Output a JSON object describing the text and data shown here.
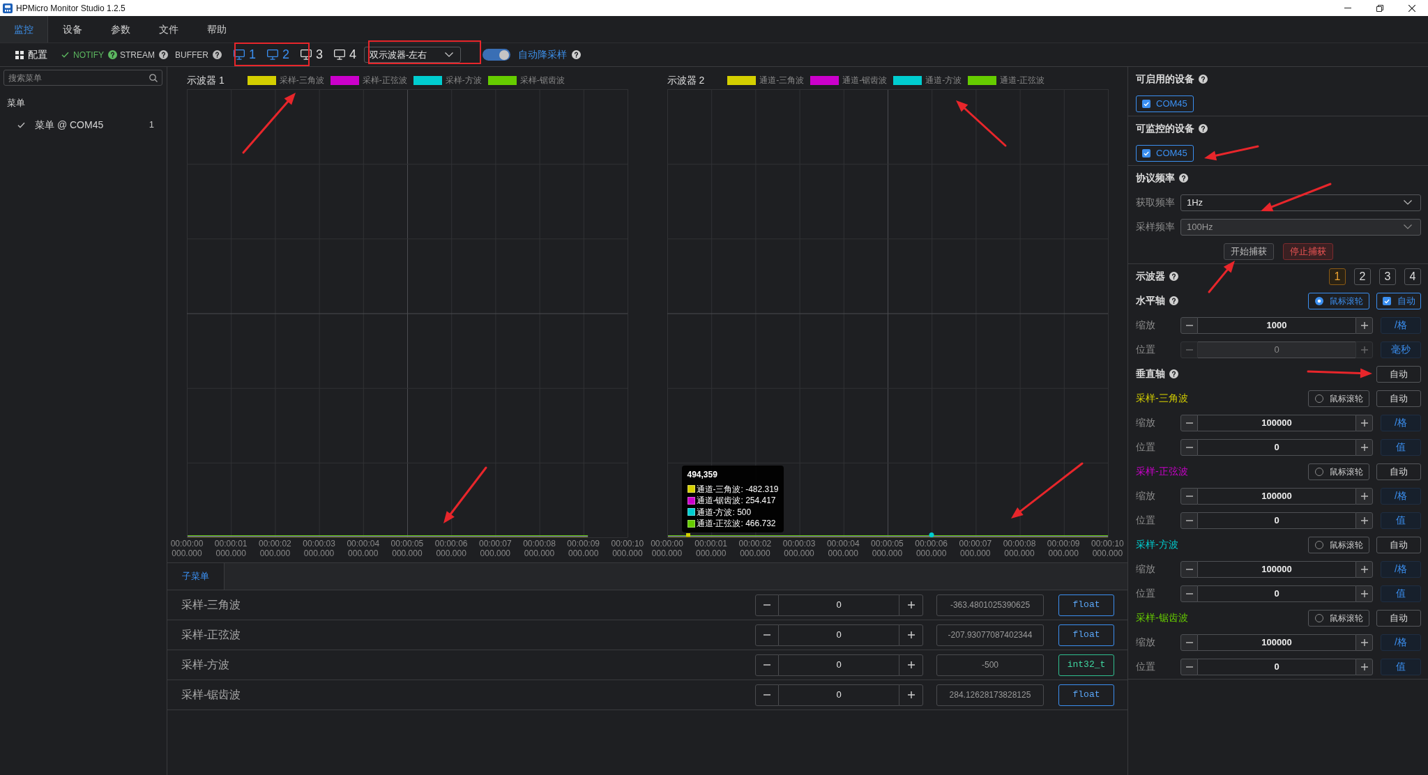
{
  "window": {
    "title": "HPMicro Monitor Studio 1.2.5"
  },
  "menu_tabs": [
    {
      "label": "监控",
      "selected": true
    },
    {
      "label": "设备",
      "selected": false
    },
    {
      "label": "参数",
      "selected": false
    },
    {
      "label": "文件",
      "selected": false
    },
    {
      "label": "帮助",
      "selected": false
    }
  ],
  "toolbar": {
    "config_label": "配置",
    "flags": [
      {
        "label": "NOTIFY",
        "active": true
      },
      {
        "label": "STREAM",
        "active": false
      },
      {
        "label": "BUFFER",
        "active": false
      }
    ],
    "scopes": [
      {
        "label": "1",
        "selected": true
      },
      {
        "label": "2",
        "selected": true
      },
      {
        "label": "3",
        "selected": false
      },
      {
        "label": "4",
        "selected": false
      }
    ],
    "layout_select": {
      "value": "双示波器-左右"
    },
    "auto_downsample": {
      "label": "自动降采样",
      "on": true
    }
  },
  "sidebar": {
    "search": {
      "placeholder": "搜索菜单"
    },
    "heading": "菜单",
    "items": [
      {
        "label": "菜单 @ COM45",
        "count": "1",
        "checked": true
      }
    ]
  },
  "oscilloscopes": [
    {
      "title": "示波器 1",
      "legend": [
        {
          "label": "采样-三角波",
          "color": "#d4cf00"
        },
        {
          "label": "采样-正弦波",
          "color": "#cc00cc"
        },
        {
          "label": "采样-方波",
          "color": "#00cdd0"
        },
        {
          "label": "采样-锯齿波",
          "color": "#66cc00"
        }
      ],
      "x_ticks": [
        {
          "time": "00:00:00",
          "fraction": "000.000"
        },
        {
          "time": "00:00:01",
          "fraction": "000.000"
        },
        {
          "time": "00:00:02",
          "fraction": "000.000"
        },
        {
          "time": "00:00:03",
          "fraction": "000.000"
        },
        {
          "time": "00:00:04",
          "fraction": "000.000"
        },
        {
          "time": "00:00:05",
          "fraction": "000.000"
        },
        {
          "time": "00:00:06",
          "fraction": "000.000"
        },
        {
          "time": "00:00:07",
          "fraction": "000.000"
        },
        {
          "time": "00:00:08",
          "fraction": "000.000"
        },
        {
          "time": "00:00:09",
          "fraction": "000.000"
        },
        {
          "time": "00:00:10",
          "fraction": "000.000"
        }
      ]
    },
    {
      "title": "示波器 2",
      "legend": [
        {
          "label": "通道-三角波",
          "color": "#d4cf00"
        },
        {
          "label": "通道-锯齿波",
          "color": "#cc00cc"
        },
        {
          "label": "通道-方波",
          "color": "#00cdd0"
        },
        {
          "label": "通道-正弦波",
          "color": "#66cc00"
        }
      ],
      "x_ticks": [
        {
          "time": "00:00:00",
          "fraction": "000.000"
        },
        {
          "time": "00:00:01",
          "fraction": "000.000"
        },
        {
          "time": "00:00:02",
          "fraction": "000.000"
        },
        {
          "time": "00:00:03",
          "fraction": "000.000"
        },
        {
          "time": "00:00:04",
          "fraction": "000.000"
        },
        {
          "time": "00:00:05",
          "fraction": "000.000"
        },
        {
          "time": "00:00:06",
          "fraction": "000.000"
        },
        {
          "time": "00:00:07",
          "fraction": "000.000"
        },
        {
          "time": "00:00:08",
          "fraction": "000.000"
        },
        {
          "time": "00:00:09",
          "fraction": "000.000"
        },
        {
          "time": "00:00:10",
          "fraction": "000.000"
        }
      ],
      "tooltip": {
        "title": "494,359",
        "items": [
          {
            "label": "通道-三角波: -482.319",
            "color": "#d4cf00"
          },
          {
            "label": "通道-锯齿波: 254.417",
            "color": "#cc00cc"
          },
          {
            "label": "通道-方波: 500",
            "color": "#00cdd0"
          },
          {
            "label": "通道-正弦波: 466.732",
            "color": "#66cc00"
          }
        ]
      }
    }
  ],
  "sub_panel": {
    "tabs": [
      {
        "label": "子菜单",
        "selected": true
      }
    ],
    "rows": [
      {
        "name": "采样-三角波",
        "step_value": "0",
        "reading": "-363.4801025390625",
        "type": "float",
        "kind": "float"
      },
      {
        "name": "采样-正弦波",
        "step_value": "0",
        "reading": "-207.93077087402344",
        "type": "float",
        "kind": "float"
      },
      {
        "name": "采样-方波",
        "step_value": "0",
        "reading": "-500",
        "type": "int32_t",
        "kind": "integer"
      },
      {
        "name": "采样-锯齿波",
        "step_value": "0",
        "reading": "284.12628173828125",
        "type": "float",
        "kind": "float"
      }
    ]
  },
  "right_panel": {
    "device_groups": [
      {
        "title": "可启用的设备",
        "devices": [
          {
            "label": "COM45",
            "checked": true
          }
        ]
      },
      {
        "title": "可监控的设备",
        "devices": [
          {
            "label": "COM45",
            "checked": true
          }
        ]
      }
    ],
    "protocol": {
      "title": "协议频率",
      "selects": [
        {
          "label": "获取频率",
          "value": "1Hz",
          "disabled": false
        },
        {
          "label": "采样频率",
          "value": "100Hz",
          "disabled": true
        }
      ],
      "buttons": [
        {
          "label": "开始捕获",
          "kind": "start"
        },
        {
          "label": "停止捕获",
          "kind": "stop"
        }
      ]
    },
    "scope_picker": {
      "title": "示波器",
      "options": [
        {
          "label": "1",
          "selected": true
        },
        {
          "label": "2",
          "selected": false
        },
        {
          "label": "3",
          "selected": false
        },
        {
          "label": "4",
          "selected": false
        }
      ]
    },
    "horizontal_axis": {
      "title": "水平轴",
      "wheel": {
        "label": "鼠标滚轮",
        "selected": true
      },
      "auto": {
        "label": "自动",
        "checked": true
      },
      "rows": [
        {
          "label": "缩放",
          "value": "1000",
          "unit": "/格",
          "disabled": false
        },
        {
          "label": "位置",
          "value": "0",
          "unit": "毫秒",
          "disabled": true
        }
      ]
    },
    "vertical_axis": {
      "title": "垂直轴",
      "auto_label": "自动",
      "channels": [
        {
          "name": "采样-三角波",
          "color": "#d4cf00",
          "wheel": {
            "label": "鼠标滚轮",
            "selected": false
          },
          "auto_label": "自动",
          "rows": [
            {
              "label": "缩放",
              "value": "100000",
              "unit": "/格"
            },
            {
              "label": "位置",
              "value": "0",
              "unit": "值"
            }
          ]
        },
        {
          "name": "采样-正弦波",
          "color": "#cc00cc",
          "wheel": {
            "label": "鼠标滚轮",
            "selected": false
          },
          "auto_label": "自动",
          "rows": [
            {
              "label": "缩放",
              "value": "100000",
              "unit": "/格"
            },
            {
              "label": "位置",
              "value": "0",
              "unit": "值"
            }
          ]
        },
        {
          "name": "采样-方波",
          "color": "#00cdd0",
          "wheel": {
            "label": "鼠标滚轮",
            "selected": false
          },
          "auto_label": "自动",
          "rows": [
            {
              "label": "缩放",
              "value": "100000",
              "unit": "/格"
            },
            {
              "label": "位置",
              "value": "0",
              "unit": "值"
            }
          ]
        },
        {
          "name": "采样-锯齿波",
          "color": "#66cc00",
          "wheel": {
            "label": "鼠标滚轮",
            "selected": false
          },
          "auto_label": "自动",
          "rows": [
            {
              "label": "缩放",
              "value": "100000",
              "unit": "/格"
            },
            {
              "label": "位置",
              "value": "0",
              "unit": "值"
            }
          ]
        }
      ]
    }
  }
}
